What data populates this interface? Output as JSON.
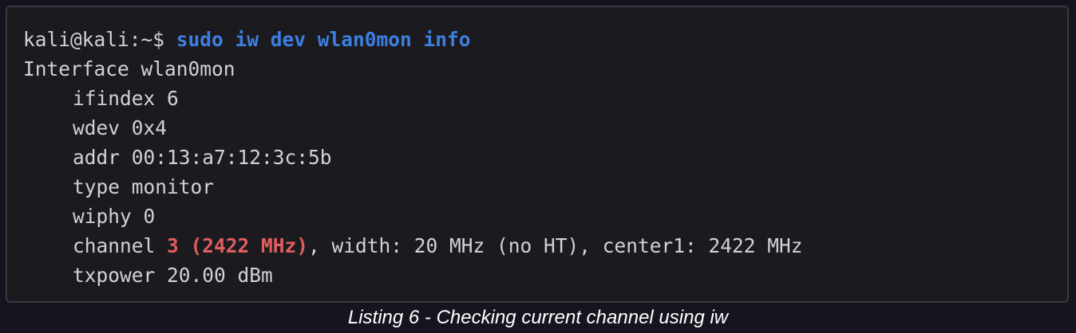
{
  "terminal": {
    "prompt": "kali@kali:~$",
    "command": "sudo iw dev wlan0mon info",
    "output": {
      "interface_line": "Interface wlan0mon",
      "ifindex": "ifindex 6",
      "wdev": "wdev 0x4",
      "addr": "addr 00:13:a7:12:3c:5b",
      "type": "type monitor",
      "wiphy": "wiphy 0",
      "channel_prefix": "channel ",
      "channel_value": "3 (2422 MHz)",
      "channel_suffix": ", width: 20 MHz (no HT), center1: 2422 MHz",
      "txpower": "txpower 20.00 dBm"
    }
  },
  "caption": "Listing 6 - Checking current channel using iw",
  "colors": {
    "background": "#1b1b1f",
    "command": "#3d7fe0",
    "highlight": "#e15d60",
    "text": "#d2d2d6"
  }
}
